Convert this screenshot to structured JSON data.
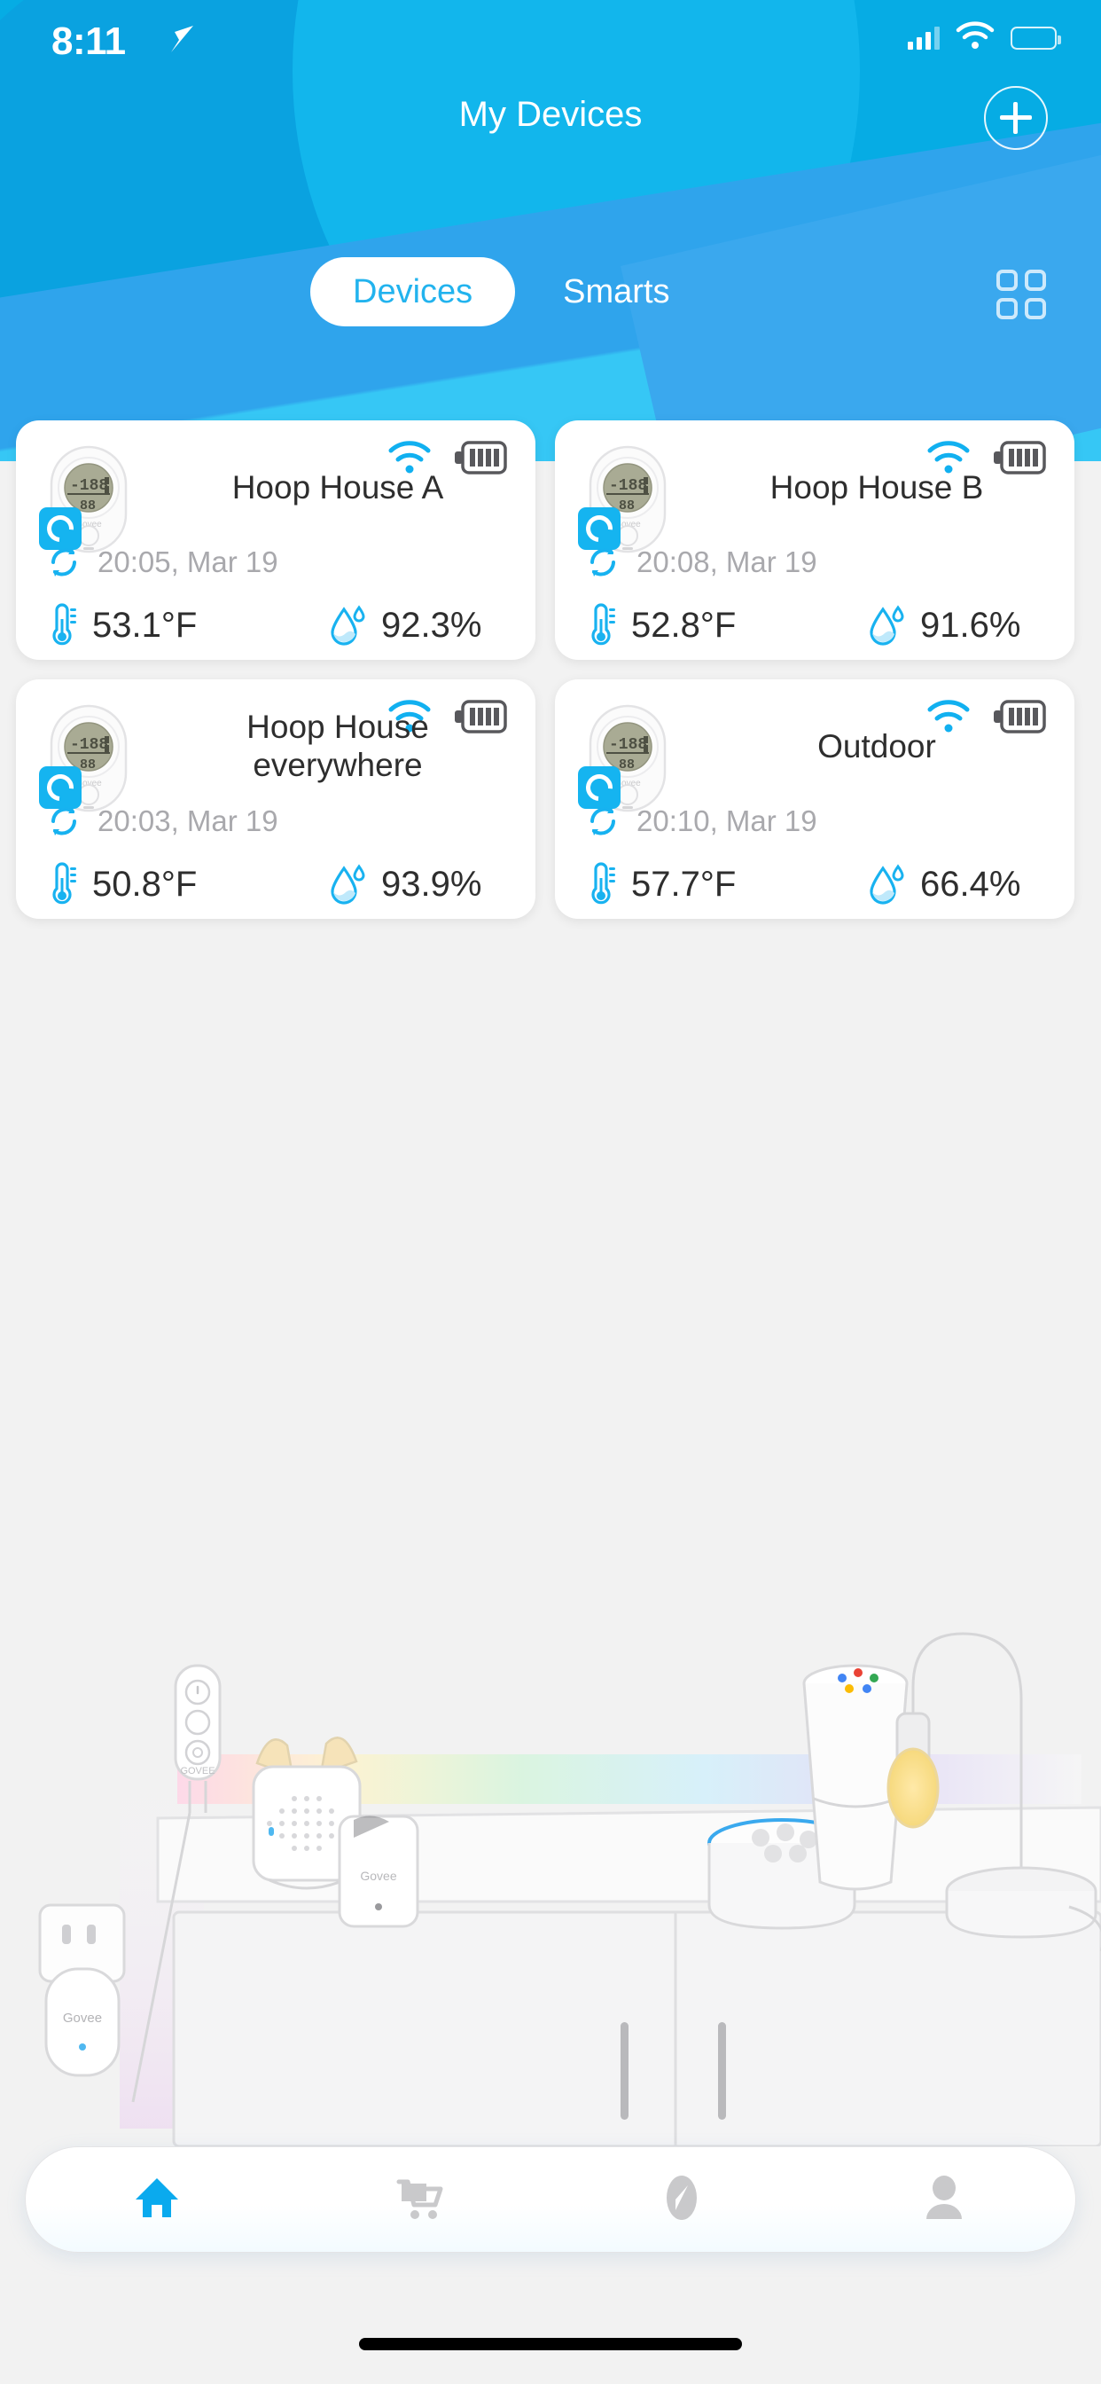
{
  "status_bar": {
    "time": "8:11",
    "location_icon": "location-arrow-icon",
    "cellular_icon": "cellular-signal-icon",
    "wifi_icon": "wifi-icon",
    "battery_icon": "battery-low-icon"
  },
  "header": {
    "title": "My Devices",
    "add_button_icon": "plus-icon",
    "grid_view_icon": "grid-view-icon",
    "accent_color": "#06ace4",
    "tabs": [
      {
        "label": "Devices",
        "active": true
      },
      {
        "label": "Smarts",
        "active": false
      }
    ]
  },
  "devices": [
    {
      "name": "Hoop House A",
      "timestamp": "20:05,  Mar 19",
      "temperature": "53.1°F",
      "humidity": "92.3%",
      "wifi_icon": "wifi-icon",
      "battery_icon": "battery-full-icon",
      "assistant_badge": "alexa-icon",
      "device_icon": "govee-thermo-hygrometer-icon",
      "refresh_icon": "refresh-icon",
      "temp_icon": "thermometer-icon",
      "humidity_icon": "water-drop-icon"
    },
    {
      "name": "Hoop House B",
      "timestamp": "20:08,  Mar 19",
      "temperature": "52.8°F",
      "humidity": "91.6%",
      "wifi_icon": "wifi-icon",
      "battery_icon": "battery-full-icon",
      "assistant_badge": "alexa-icon",
      "device_icon": "govee-thermo-hygrometer-icon",
      "refresh_icon": "refresh-icon",
      "temp_icon": "thermometer-icon",
      "humidity_icon": "water-drop-icon"
    },
    {
      "name": "Hoop House everywhere",
      "timestamp": "20:03,  Mar 19",
      "temperature": "50.8°F",
      "humidity": "93.9%",
      "wifi_icon": "wifi-icon",
      "battery_icon": "battery-full-icon",
      "assistant_badge": "alexa-icon",
      "device_icon": "govee-thermo-hygrometer-icon",
      "refresh_icon": "refresh-icon",
      "temp_icon": "thermometer-icon",
      "humidity_icon": "water-drop-icon"
    },
    {
      "name": "Outdoor",
      "timestamp": "20:10,  Mar 19",
      "temperature": "57.7°F",
      "humidity": "66.4%",
      "wifi_icon": "wifi-icon",
      "battery_icon": "battery-full-icon",
      "assistant_badge": "alexa-icon",
      "device_icon": "govee-thermo-hygrometer-icon",
      "refresh_icon": "refresh-icon",
      "temp_icon": "thermometer-icon",
      "humidity_icon": "water-drop-icon"
    }
  ],
  "illustration": {
    "brand_label": "Govee",
    "controller_label": "GOVEE",
    "sensor_label": "Govee",
    "items": [
      "govee-smart-plug",
      "govee-led-controller",
      "cat-ear-speaker",
      "govee-sensor-tag",
      "amazon-echo-dot",
      "google-home-speaker",
      "desk-lamp"
    ]
  },
  "bottom_nav": {
    "active_color": "#0aaaee",
    "inactive_color": "#c9c9cb",
    "items": [
      {
        "icon": "home-icon",
        "active": true
      },
      {
        "icon": "shopping-cart-icon",
        "active": false
      },
      {
        "icon": "compass-icon",
        "active": false
      },
      {
        "icon": "profile-icon",
        "active": false
      }
    ]
  }
}
